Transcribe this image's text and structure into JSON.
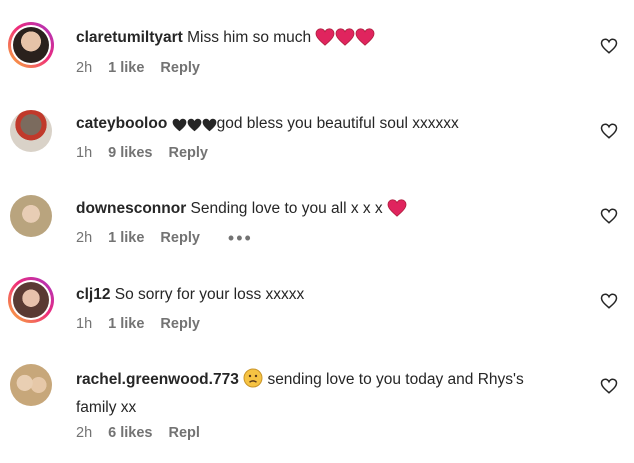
{
  "comments": [
    {
      "username": "claretumiltyart",
      "text": "Miss him so much",
      "time": "2h",
      "likes": "1 like",
      "reply": "Reply",
      "emojis": [
        "red-heart-emoji",
        "red-heart-emoji",
        "red-heart-emoji"
      ],
      "avatar_story_ring": true
    },
    {
      "username": "cateybooloo",
      "prefix_emojis": [
        "black-heart-emoji",
        "black-heart-emoji",
        "black-heart-emoji"
      ],
      "text": "god bless you beautiful soul xxxxxx",
      "time": "1h",
      "likes": "9 likes",
      "reply": "Reply",
      "avatar_story_ring": false
    },
    {
      "username": "downesconnor",
      "text": "Sending love to you all x x x",
      "time": "2h",
      "likes": "1 like",
      "reply": "Reply",
      "more": "•••",
      "emojis": [
        "red-heart-emoji"
      ],
      "avatar_story_ring": false
    },
    {
      "username": "clj12",
      "text": "So sorry for your loss xxxxx",
      "time": "1h",
      "likes": "1 like",
      "reply": "Reply",
      "avatar_story_ring": true
    },
    {
      "username": "rachel.greenwood.773",
      "emoji_before_text": "sad-face-emoji",
      "text": "sending love to you today and Rhys's family xx",
      "time": "2h",
      "likes": "6 likes",
      "reply": "Repl",
      "avatar_story_ring": false
    }
  ],
  "colors": {
    "text": "#262626",
    "meta": "#737373",
    "heart_red": "#e0245e",
    "ring_start": "#f9b338",
    "ring_end": "#a235c6"
  }
}
